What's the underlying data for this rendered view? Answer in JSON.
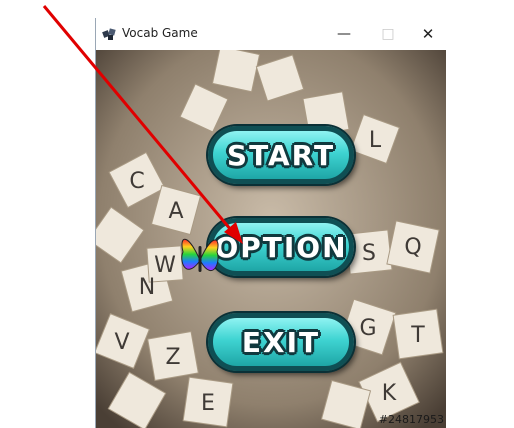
{
  "window": {
    "title": "Vocab Game",
    "controls": {
      "minimize": "—",
      "maximize": "□",
      "close": "✕"
    }
  },
  "menu": {
    "start_label": "START",
    "option_label": "OPTION",
    "exit_label": "EXIT"
  },
  "background": {
    "tile_letters": [
      "W",
      "S",
      "C",
      "N",
      "Z",
      "V",
      "G",
      "E",
      "K",
      "T",
      "A",
      "Q",
      "L"
    ],
    "watermark": "#24817953"
  },
  "icons": {
    "app": "game-controller-icon",
    "butterfly": "butterfly-icon"
  },
  "colors": {
    "button_fill": "#3fd4d2",
    "button_border": "#0f4f54",
    "arrow": "#e00000"
  }
}
